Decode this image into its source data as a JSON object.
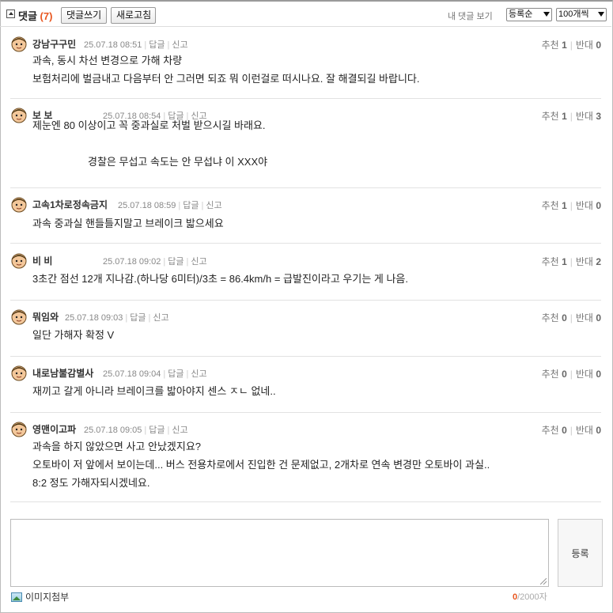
{
  "header": {
    "title": "댓글",
    "count": "(7)",
    "write_label": "댓글쓰기",
    "refresh_label": "새로고침",
    "my_comments": "내 댓글 보기",
    "sort_value": "등록순",
    "per_page_value": "100개씩"
  },
  "vote_labels": {
    "up": "추천",
    "down": "반대"
  },
  "reply_label": "답글",
  "report_label": "신고",
  "comments": [
    {
      "nick": "강남구구민",
      "date": "25.07.18 08:51",
      "up": "1",
      "down": "0",
      "lines": [
        "과속, 동시 차선 변경으로 가해 차량",
        "보험처리에 벌금내고 다음부터 안 그러면 되죠 뭐 이런걸로 떠시나요. 잘 해결되길 바랍니다."
      ]
    },
    {
      "nick": "보 보",
      "date": "25.07.18 08:54",
      "up": "1",
      "down": "3",
      "lines": [
        "제눈엔 80 이상이고 꼭 중과실로 처벌 받으시길 바래요.",
        "",
        "경찰은 무섭고 속도는 안 무섭냐 이 XXX야"
      ]
    },
    {
      "nick": "고속1차로정속금지",
      "date": "25.07.18 08:59",
      "up": "1",
      "down": "0",
      "lines": [
        "과속 중과실 핸들틀지말고 브레이크 밟으세요"
      ]
    },
    {
      "nick": "비 비",
      "date": "25.07.18 09:02",
      "up": "1",
      "down": "2",
      "lines": [
        "3초간 점선 12개 지나감.(하나당 6미터)/3초 = 86.4km/h = 급발진이라고 우기는 게 나음."
      ]
    },
    {
      "nick": "뭐임와",
      "date": "25.07.18 09:03",
      "up": "0",
      "down": "0",
      "lines": [
        "일단 가해자 확정 V"
      ]
    },
    {
      "nick": "내로남불감별사",
      "date": "25.07.18 09:04",
      "up": "0",
      "down": "0",
      "lines": [
        "재끼고 갈게 아니라 브레이크를 밟아야지 센스 ㅈㄴ 없네.."
      ]
    },
    {
      "nick": "영맨이고파",
      "date": "25.07.18 09:05",
      "up": "0",
      "down": "0",
      "lines": [
        "과속을 하지 않았으면 사고 안났겠지요?",
        "오토바이 저 앞에서 보이는데... 버스 전용차로에서 진입한 건 문제없고, 2개차로 연속 변경만 오토바이 과실..",
        "8:2 정도 가해자되시겠네요."
      ]
    }
  ],
  "editor": {
    "submit_label": "등록",
    "attach_label": "이미지첨부",
    "char_current": "0",
    "char_limit": "/2000자"
  },
  "colors": {
    "accent": "#e8561f",
    "divider": "#e2e2e2"
  }
}
